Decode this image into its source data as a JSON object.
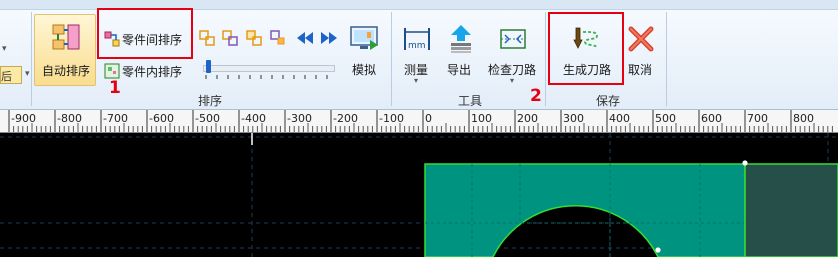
{
  "ribbon": {
    "partial_left_label": "后",
    "auto_sort": "自动排序",
    "sort_between_parts": "零件间排序",
    "sort_within_part": "零件内排序",
    "simulate": "模拟",
    "measure": "测量",
    "export": "导出",
    "check_toolpath": "检查刀路",
    "generate_toolpath": "生成刀路",
    "cancel": "取消"
  },
  "groups": {
    "sort": "排序",
    "tools": "工具",
    "save": "保存"
  },
  "annotations": {
    "marker_1": "1",
    "marker_2": "2"
  },
  "ruler": {
    "labels": [
      "-900",
      "-800",
      "-700",
      "-600",
      "-500",
      "-400",
      "-300",
      "-200",
      "-100",
      "0",
      "100",
      "200",
      "300",
      "400",
      "500",
      "600",
      "700",
      "800"
    ]
  },
  "colors": {
    "highlight": "#e60012",
    "part_fill": "#009480",
    "part_outline": "#33dd33",
    "canvas": "#000000"
  }
}
